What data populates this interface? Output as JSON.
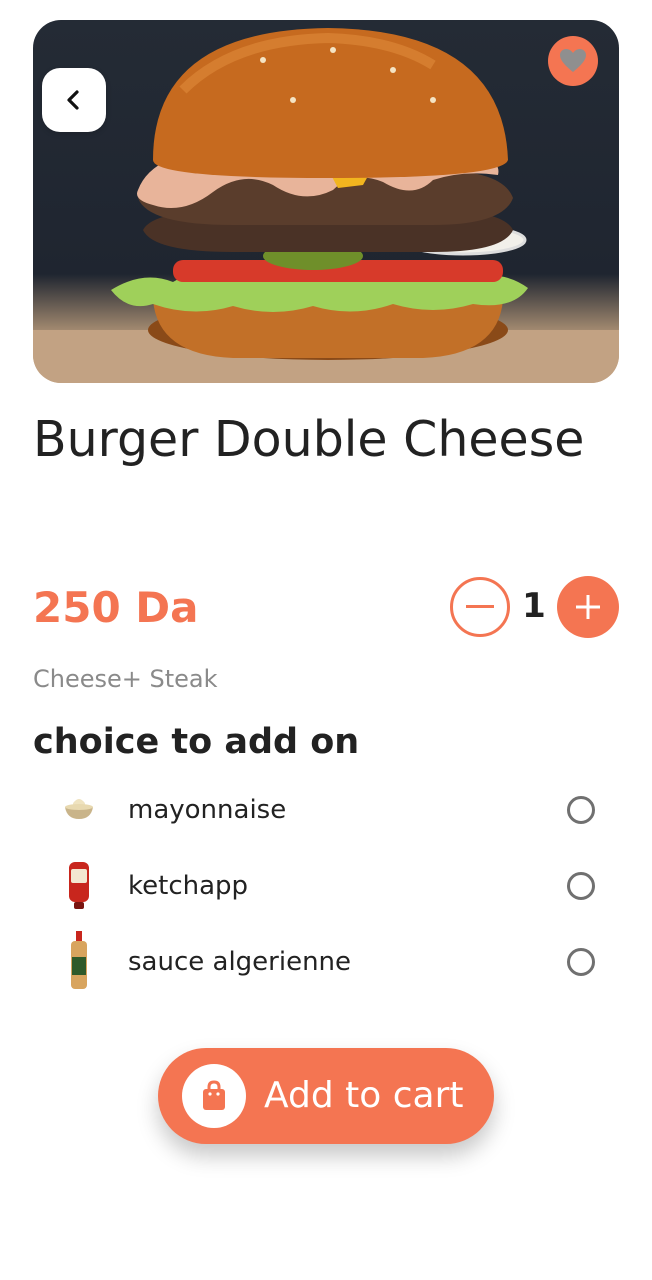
{
  "product": {
    "image_alt": "Double cheese burger",
    "title": "Burger Double Cheese",
    "price": "250 Da",
    "quantity": "1",
    "description": "Cheese+ Steak"
  },
  "addons": {
    "heading": "choice to add on",
    "items": [
      {
        "label": "mayonnaise",
        "icon": "mayonnaise-bowl-icon",
        "selected": false
      },
      {
        "label": "ketchapp",
        "icon": "ketchup-bottle-icon",
        "selected": false
      },
      {
        "label": "sauce algerienne",
        "icon": "sauce-bottle-icon",
        "selected": false
      }
    ]
  },
  "actions": {
    "add_to_cart": "Add to cart"
  },
  "icons": {
    "back": "chevron-left-icon",
    "favorite": "heart-icon",
    "decrement": "minus-icon",
    "increment": "plus-icon",
    "cart": "shopping-bag-icon"
  },
  "colors": {
    "accent": "#f47552",
    "text": "#222222",
    "muted": "#8a8a8a"
  }
}
